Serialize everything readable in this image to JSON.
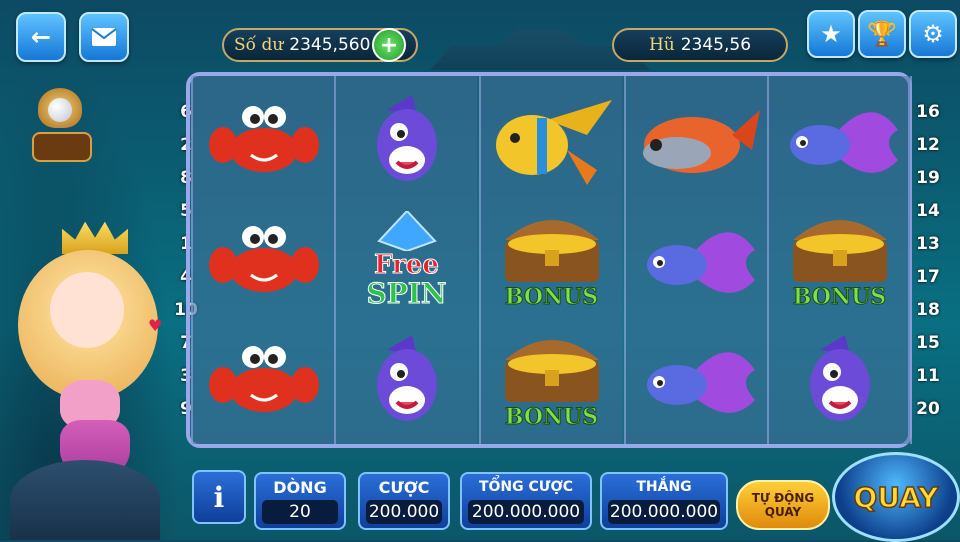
{
  "balance": {
    "label": "Số dư",
    "value": "2345,560"
  },
  "jackpot": {
    "label": "Hũ",
    "value": "2345,56"
  },
  "left_lines": [
    "6",
    "2",
    "8",
    "5",
    "1",
    "4",
    "10",
    "7",
    "3",
    "9"
  ],
  "right_lines": [
    "16",
    "12",
    "19",
    "14",
    "13",
    "17",
    "18",
    "15",
    "11",
    "20"
  ],
  "reels": [
    [
      "crab",
      "crab",
      "crab"
    ],
    [
      "purple-fish",
      "free-spin",
      "purple-fish"
    ],
    [
      "yellow-fish",
      "bonus-chest",
      "bonus-chest"
    ],
    [
      "red-fish",
      "betta-fish",
      "betta-fish"
    ],
    [
      "betta-fish",
      "bonus-chest",
      "purple-fish"
    ]
  ],
  "symbol_text": {
    "free": "Free",
    "spin": "SPIN",
    "bonus": "BONUS"
  },
  "bottom": {
    "info": "i",
    "lines": {
      "label": "DÒNG",
      "value": "20"
    },
    "bet": {
      "label": "CƯỢC",
      "value": "200.000"
    },
    "total_bet": {
      "label": "TỔNG CƯỢC",
      "value": "200.000.000"
    },
    "win": {
      "label": "THẮNG",
      "value": "200.000.000"
    },
    "auto_spin": {
      "line1": "TỰ ĐỘNG",
      "line2": "QUAY"
    },
    "spin": "QUAY"
  },
  "colors": {
    "accent_gold": "#f2d27a",
    "panel_blue": "#1f5fc8",
    "bonus_green": "#7fe04a"
  }
}
